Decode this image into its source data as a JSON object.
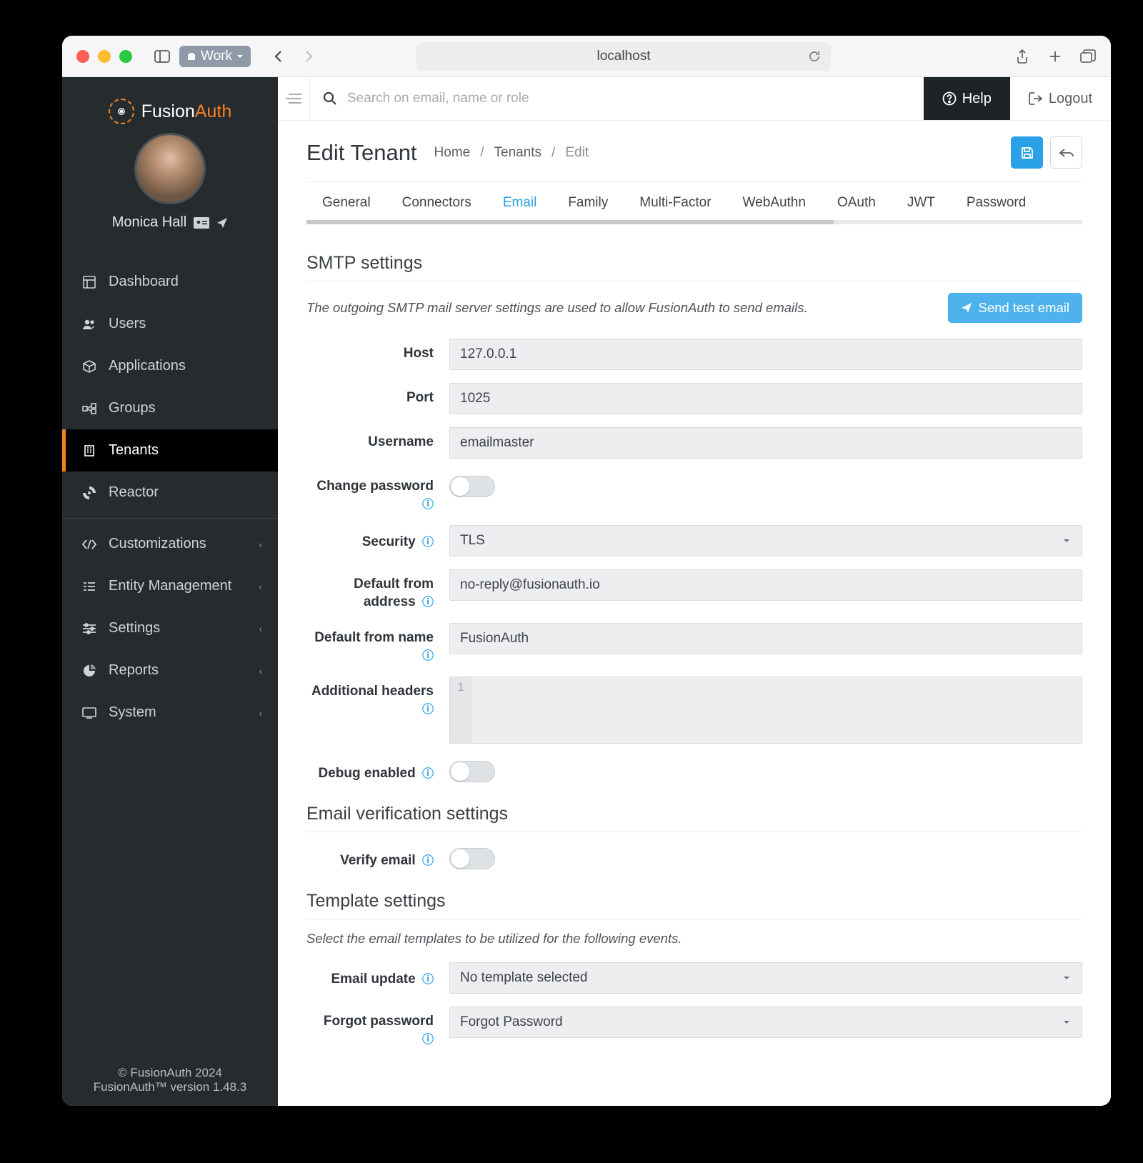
{
  "browser": {
    "work_label": "Work",
    "url": "localhost"
  },
  "logo": {
    "brand_prefix": "Fusion",
    "brand_suffix": "Auth"
  },
  "user": {
    "name": "Monica Hall"
  },
  "nav": {
    "dashboard": "Dashboard",
    "users": "Users",
    "applications": "Applications",
    "groups": "Groups",
    "tenants": "Tenants",
    "reactor": "Reactor",
    "customizations": "Customizations",
    "entity": "Entity Management",
    "settings": "Settings",
    "reports": "Reports",
    "system": "System"
  },
  "footer": {
    "copyright": "© FusionAuth 2024",
    "version": "FusionAuth™ version 1.48.3"
  },
  "topbar": {
    "search_placeholder": "Search on email, name or role",
    "help": "Help",
    "logout": "Logout"
  },
  "page": {
    "title": "Edit Tenant",
    "crumbs": {
      "home": "Home",
      "tenants": "Tenants",
      "edit": "Edit"
    }
  },
  "tabs": {
    "general": "General",
    "connectors": "Connectors",
    "email": "Email",
    "family": "Family",
    "multifactor": "Multi-Factor",
    "webauthn": "WebAuthn",
    "oauth": "OAuth",
    "jwt": "JWT",
    "password": "Password"
  },
  "smtp": {
    "heading": "SMTP settings",
    "desc": "The outgoing SMTP mail server settings are used to allow FusionAuth to send emails.",
    "send_test": "Send test email",
    "labels": {
      "host": "Host",
      "port": "Port",
      "username": "Username",
      "change_password": "Change password",
      "security": "Security",
      "default_from_address": "Default from address",
      "default_from_name": "Default from name",
      "additional_headers": "Additional headers",
      "debug_enabled": "Debug enabled"
    },
    "values": {
      "host": "127.0.0.1",
      "port": "1025",
      "username": "emailmaster",
      "security": "TLS",
      "default_from_address": "no-reply@fusionauth.io",
      "default_from_name": "FusionAuth",
      "headers_line": "1"
    }
  },
  "verification": {
    "heading": "Email verification settings",
    "labels": {
      "verify_email": "Verify email"
    }
  },
  "templates": {
    "heading": "Template settings",
    "desc": "Select the email templates to be utilized for the following events.",
    "labels": {
      "email_update": "Email update",
      "forgot_password": "Forgot password"
    },
    "values": {
      "email_update": "No template selected",
      "forgot_password": "Forgot Password"
    }
  }
}
